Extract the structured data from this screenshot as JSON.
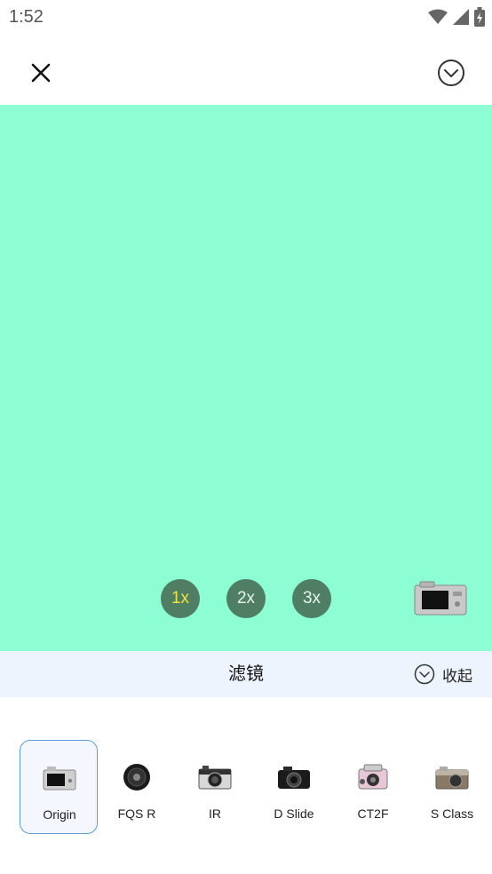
{
  "status_bar": {
    "time": "1:52",
    "icons": [
      "wifi-icon",
      "signal-icon",
      "battery-charging-icon"
    ]
  },
  "topbar": {
    "close_icon": "close-icon",
    "confirm_icon": "check-circle-icon"
  },
  "preview": {
    "background_color": "#8dfdd3",
    "zoom_options": [
      {
        "label": "1x",
        "active": true
      },
      {
        "label": "2x",
        "active": false
      },
      {
        "label": "3x",
        "active": false
      }
    ],
    "camera_thumbnail_icon": "camera-icon"
  },
  "filters": {
    "title": "滤镜",
    "collapse_label": "收起",
    "items": [
      {
        "label": "Origin",
        "selected": true,
        "icon": "camera-icon"
      },
      {
        "label": "FQS R",
        "selected": false,
        "icon": "lens-icon"
      },
      {
        "label": "IR",
        "selected": false,
        "icon": "camera-icon"
      },
      {
        "label": "D Slide",
        "selected": false,
        "icon": "camera-icon"
      },
      {
        "label": "CT2F",
        "selected": false,
        "icon": "camera-icon"
      },
      {
        "label": "S Class",
        "selected": false,
        "icon": "camera-icon"
      }
    ]
  },
  "colors": {
    "accent_border": "#5b9ee0",
    "zoom_bg": "#4f7e64",
    "zoom_active_text": "#f2e23a"
  }
}
